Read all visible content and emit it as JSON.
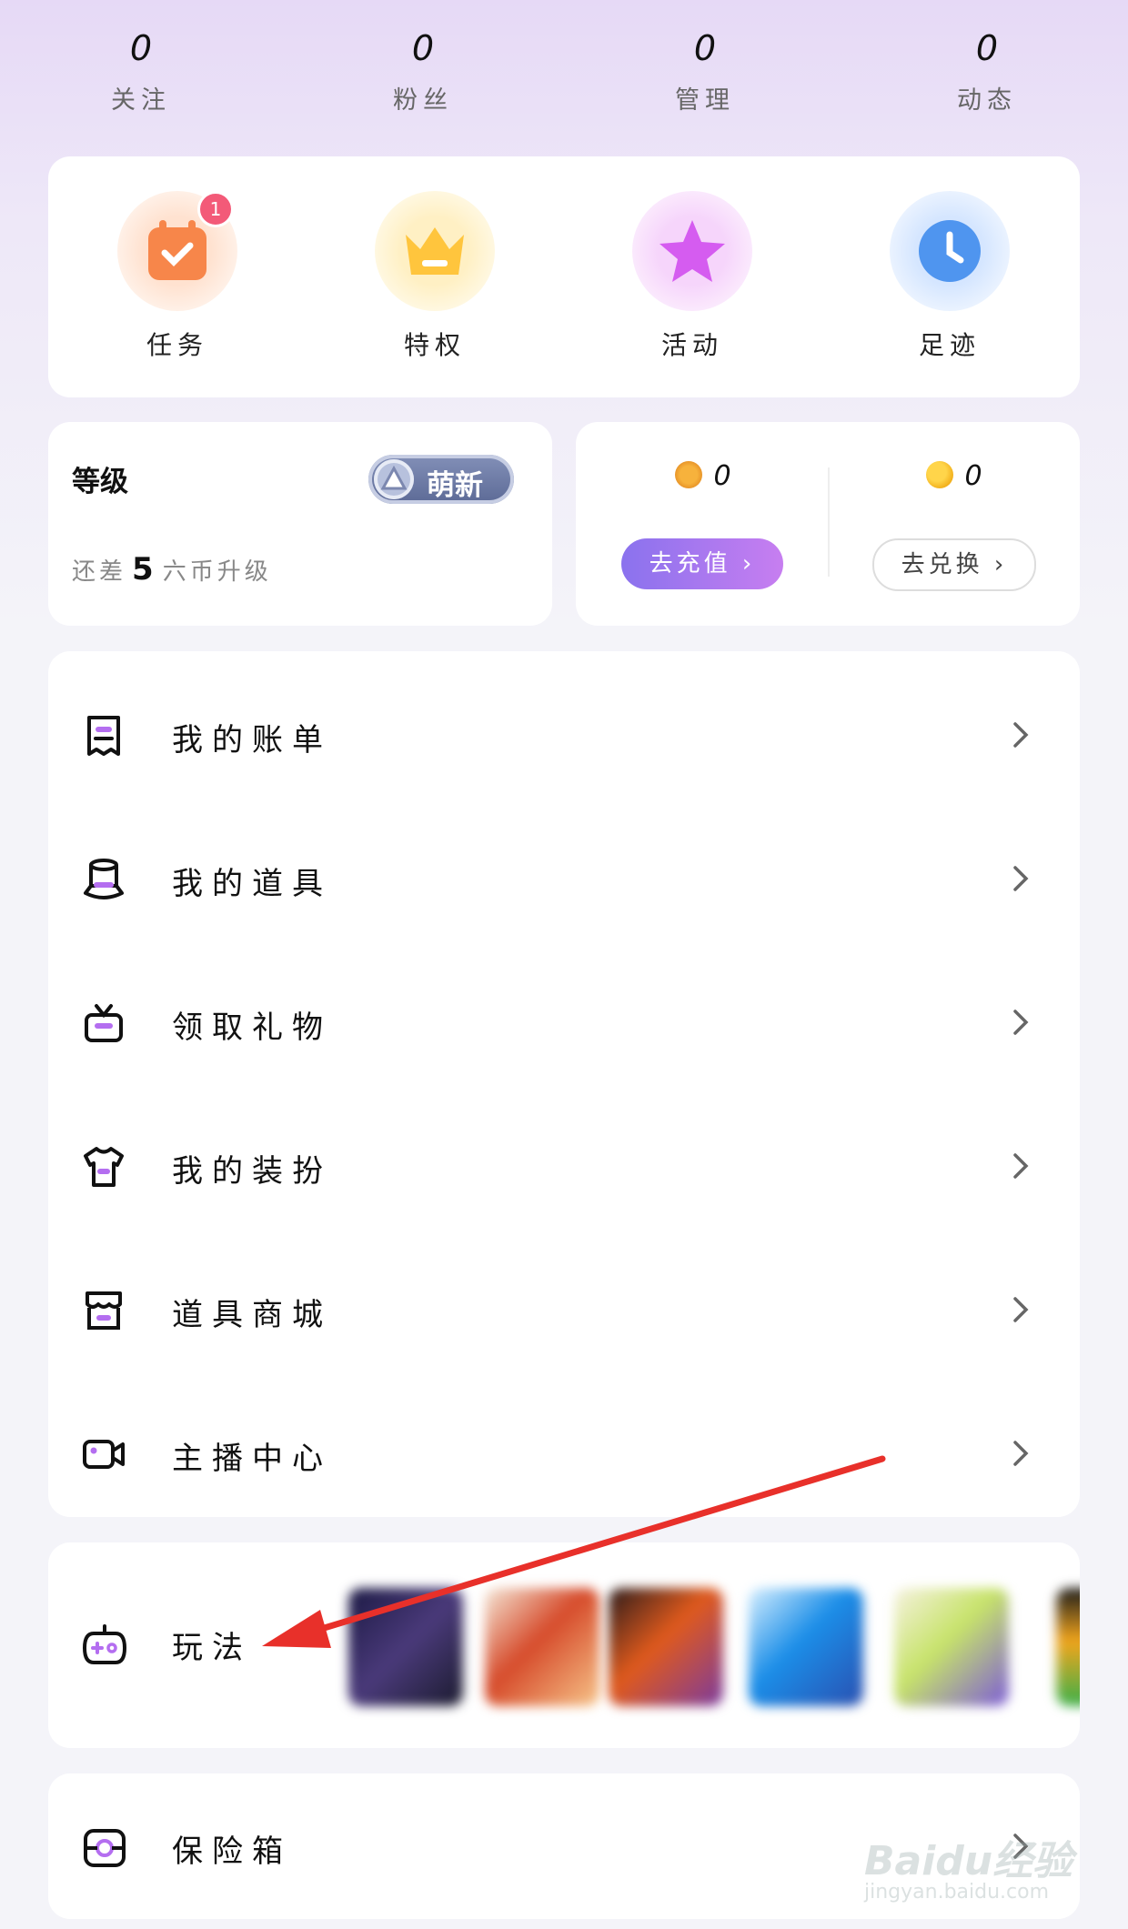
{
  "stats": [
    {
      "value": "0",
      "label": "关注"
    },
    {
      "value": "0",
      "label": "粉丝"
    },
    {
      "value": "0",
      "label": "管理"
    },
    {
      "value": "0",
      "label": "动态"
    }
  ],
  "quick": [
    {
      "label": "任务",
      "icon": "task-calendar-icon",
      "badge": "1"
    },
    {
      "label": "特权",
      "icon": "crown-icon"
    },
    {
      "label": "活动",
      "icon": "star-icon"
    },
    {
      "label": "足迹",
      "icon": "clock-icon"
    }
  ],
  "level": {
    "title": "等级",
    "badge": "萌新",
    "hint_prefix": "还差",
    "hint_number": "5",
    "hint_suffix": "六币升级"
  },
  "wallet": {
    "coin_value": "0",
    "bean_value": "0",
    "recharge_label": "去充值 ›",
    "exchange_label": "去兑换 ›"
  },
  "menu": [
    {
      "label": "我的账单",
      "icon": "receipt-icon"
    },
    {
      "label": "我的道具",
      "icon": "magic-hat-icon"
    },
    {
      "label": "领取礼物",
      "icon": "gift-icon"
    },
    {
      "label": "我的装扮",
      "icon": "tshirt-icon"
    },
    {
      "label": "道具商城",
      "icon": "store-icon"
    },
    {
      "label": "主播中心",
      "icon": "video-camera-icon"
    }
  ],
  "play": {
    "label": "玩法",
    "icon": "gamepad-icon"
  },
  "safe": {
    "label": "保险箱",
    "icon": "safe-box-icon"
  },
  "watermark": {
    "line1": "Baidu经验",
    "line2": "jingyan.baidu.com"
  },
  "colors": {
    "accent": "#9b74ee",
    "annotation_arrow": "#e8302a",
    "badge": "#f35a78"
  }
}
